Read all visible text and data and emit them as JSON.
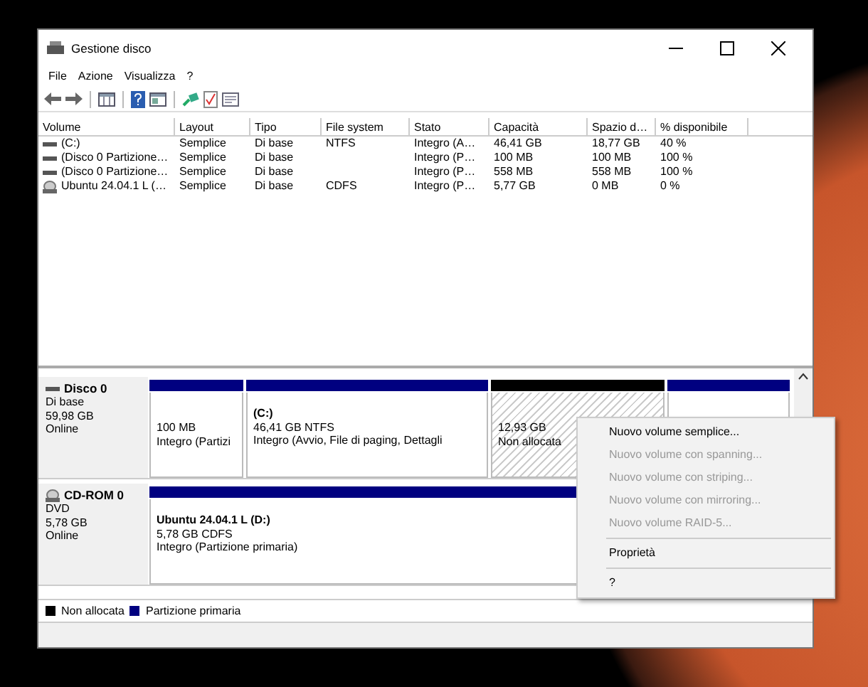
{
  "window": {
    "title": "Gestione disco"
  },
  "menu": [
    "File",
    "Azione",
    "Visualizza",
    "?"
  ],
  "table": {
    "columns": [
      "Volume",
      "Layout",
      "Tipo",
      "File system",
      "Stato",
      "Capacità",
      "Spazio d…",
      "% disponibile"
    ],
    "rows": [
      {
        "kind": "drive",
        "cells": [
          "(C:)",
          "Semplice",
          "Di base",
          "NTFS",
          "Integro (A…",
          "46,41 GB",
          "18,77 GB",
          "40 %"
        ]
      },
      {
        "kind": "drive",
        "cells": [
          "(Disco 0 Partizione…",
          "Semplice",
          "Di base",
          "",
          "Integro (P…",
          "100 MB",
          "100 MB",
          "100 %"
        ]
      },
      {
        "kind": "drive",
        "cells": [
          "(Disco 0 Partizione…",
          "Semplice",
          "Di base",
          "",
          "Integro (P…",
          "558 MB",
          "558 MB",
          "100 %"
        ]
      },
      {
        "kind": "cd",
        "cells": [
          "Ubuntu 24.04.1 L (…",
          "Semplice",
          "Di base",
          "CDFS",
          "Integro (P…",
          "5,77 GB",
          "0 MB",
          "0 %"
        ]
      }
    ]
  },
  "disks": [
    {
      "kind": "drive",
      "name": "Disco 0",
      "lines": [
        "Di base",
        "59,98 GB",
        "Online"
      ],
      "partitions": [
        {
          "kind": "primary",
          "lines": [
            "100 MB",
            "Integro (Partizi"
          ]
        },
        {
          "kind": "primary",
          "title": "(C:)",
          "lines": [
            "46,41 GB NTFS",
            "Integro (Avvio, File di paging, Dettagli"
          ]
        },
        {
          "kind": "unallocated",
          "lines": [
            "12,93 GB",
            "Non allocata"
          ]
        },
        {
          "kind": "primary"
        }
      ]
    },
    {
      "kind": "cd",
      "name": "CD-ROM 0",
      "lines": [
        "DVD",
        "5,78 GB",
        "Online"
      ],
      "partitions": [
        {
          "kind": "primary",
          "title": "Ubuntu 24.04.1 L  (D:)",
          "lines": [
            "5,78 GB CDFS",
            "Integro (Partizione primaria)"
          ]
        }
      ]
    }
  ],
  "legend": [
    {
      "label": "Non allocata",
      "color": "#000000"
    },
    {
      "label": "Partizione primaria",
      "color": "#000080"
    }
  ],
  "context_menu": [
    {
      "kind": "item",
      "label": "Nuovo volume semplice...",
      "disabled": false
    },
    {
      "kind": "item",
      "label": "Nuovo volume con spanning...",
      "disabled": true
    },
    {
      "kind": "item",
      "label": "Nuovo volume con striping...",
      "disabled": true
    },
    {
      "kind": "item",
      "label": "Nuovo volume con mirroring...",
      "disabled": true
    },
    {
      "kind": "item",
      "label": "Nuovo volume RAID-5...",
      "disabled": true
    },
    {
      "kind": "separator"
    },
    {
      "kind": "item",
      "label": "Proprietà",
      "disabled": false
    },
    {
      "kind": "separator"
    },
    {
      "kind": "item",
      "label": "?",
      "disabled": false
    }
  ]
}
